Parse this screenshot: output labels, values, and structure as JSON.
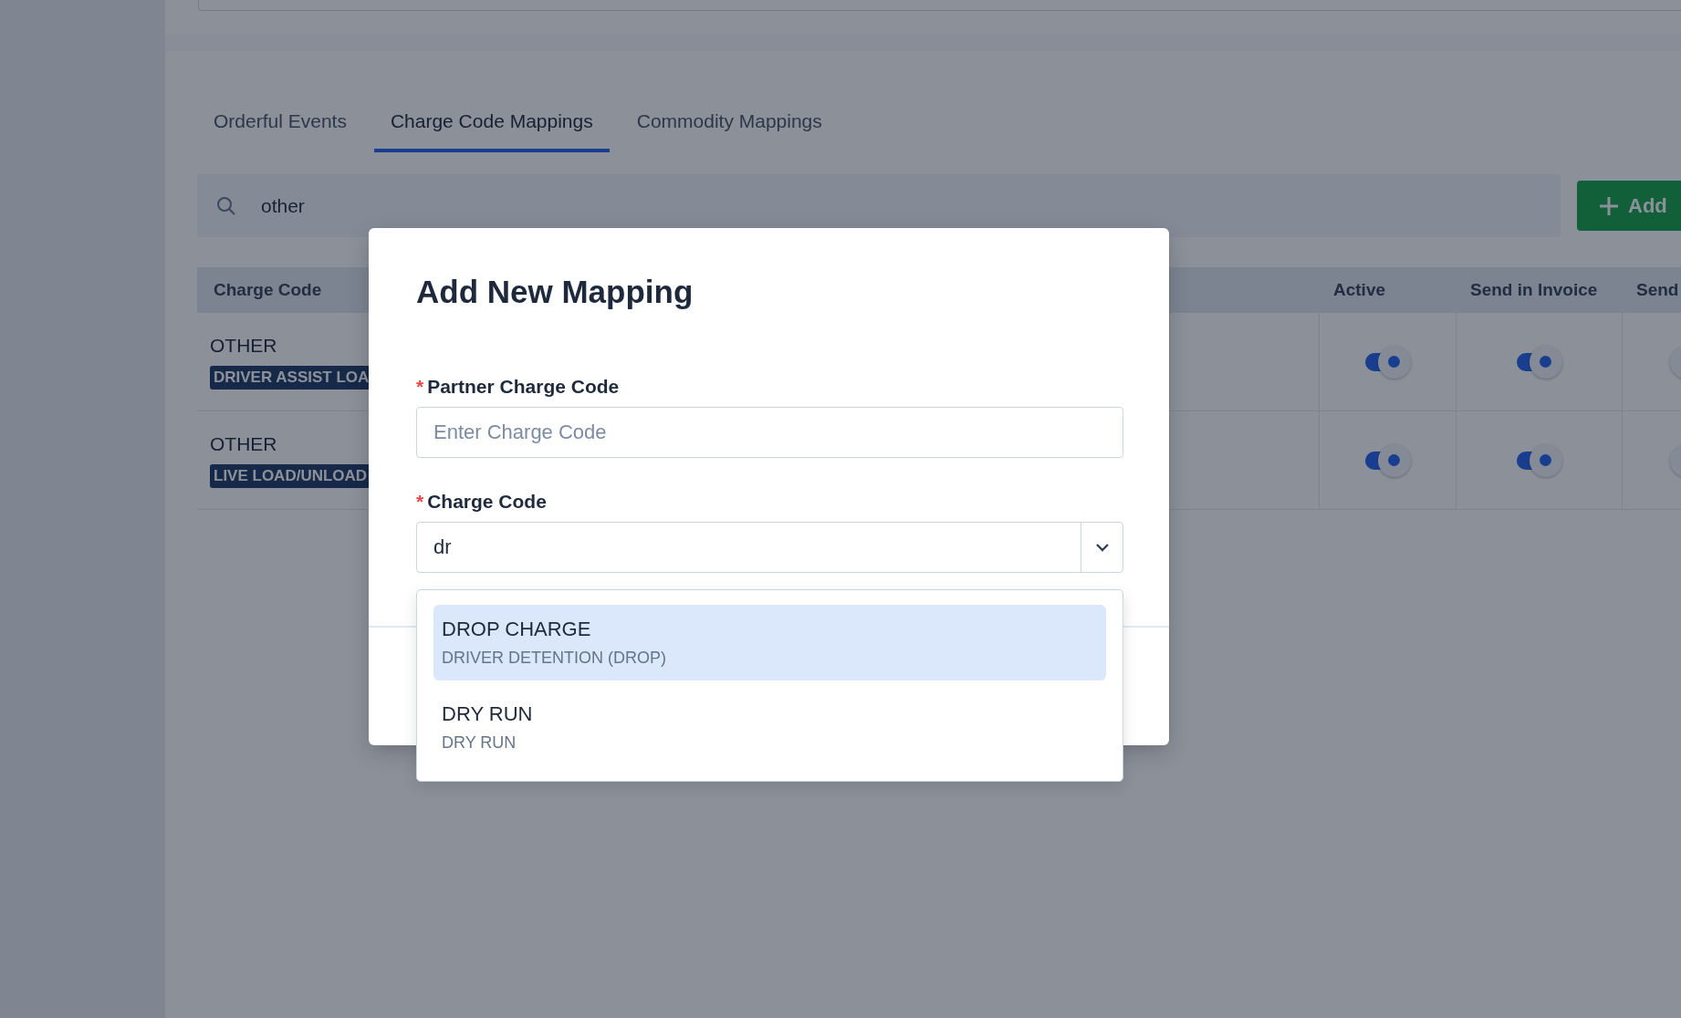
{
  "tabs": [
    {
      "label": "Orderful Events",
      "selected": false
    },
    {
      "label": "Charge Code Mappings",
      "selected": true
    },
    {
      "label": "Commodity Mappings",
      "selected": false
    }
  ],
  "search": {
    "value": "other"
  },
  "add_button": {
    "label": "Add"
  },
  "table": {
    "columns": [
      "Charge Code",
      "Active",
      "Send in Invoice",
      "Send"
    ],
    "rows": [
      {
        "charge_code": "OTHER",
        "tag": "DRIVER ASSIST LOA",
        "active": true,
        "send_in_invoice": true
      },
      {
        "charge_code": "OTHER",
        "tag": "LIVE LOAD/UNLOAD",
        "active": true,
        "send_in_invoice": true
      }
    ]
  },
  "dialog": {
    "title": "Add New Mapping",
    "fields": [
      {
        "kind": "text",
        "mark": "*",
        "label": "Partner Charge Code",
        "placeholder": "Enter Charge Code"
      },
      {
        "kind": "combo",
        "mark": "*",
        "label": "Charge Code",
        "value": "dr"
      }
    ],
    "options": [
      {
        "title": "DROP CHARGE",
        "subtitle": "DRIVER DETENTION (DROP)",
        "selected": true
      },
      {
        "title": "DRY RUN",
        "subtitle": "DRY RUN",
        "selected": false
      }
    ]
  }
}
